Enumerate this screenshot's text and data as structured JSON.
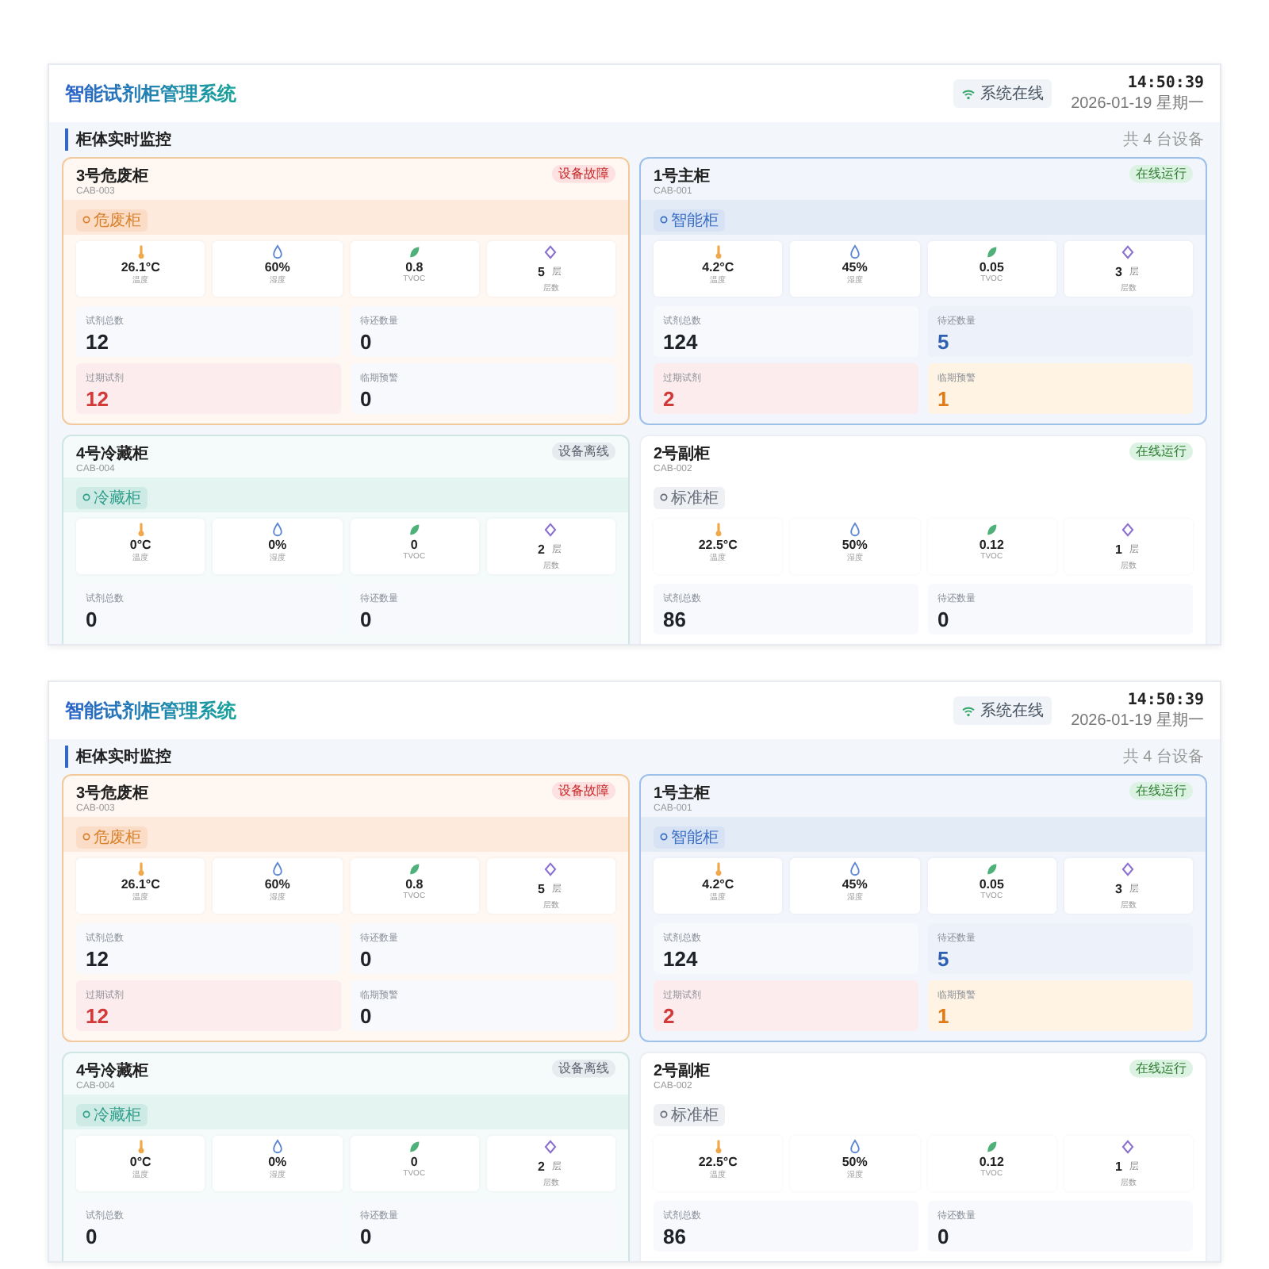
{
  "screens": [
    {
      "header": {
        "title": "智能试剂柜管理系统",
        "status": "系统在线",
        "time": "14:50:39",
        "date": "2026-01-19 星期一"
      },
      "section": {
        "title": "柜体实时监控",
        "count": "共 4 台设备"
      },
      "cabinets": [
        {
          "name": "3号危废柜",
          "code": "CAB-003",
          "kind": "hazard",
          "status": {
            "label": "设备故障",
            "kind": "fault"
          },
          "tag": "危废柜",
          "metrics": [
            {
              "kind": "temperature",
              "value": "26.1°C",
              "label": "温度"
            },
            {
              "kind": "humidity",
              "value": "60%",
              "label": "湿度"
            },
            {
              "kind": "tvoc",
              "value": "0.8",
              "label": "TVOC"
            },
            {
              "kind": "layers",
              "value": "5",
              "unit": "层",
              "label": "层数"
            }
          ],
          "stats": [
            {
              "label": "试剂总数",
              "value": "12",
              "kind": "normal"
            },
            {
              "label": "待还数量",
              "value": "0",
              "kind": "normal"
            },
            {
              "label": "过期试剂",
              "value": "12",
              "kind": "alert"
            },
            {
              "label": "临期预警",
              "value": "0",
              "kind": "normal"
            }
          ]
        },
        {
          "name": "1号主柜",
          "code": "CAB-001",
          "kind": "main",
          "status": {
            "label": "在线运行",
            "kind": "online"
          },
          "tag": "智能柜",
          "metrics": [
            {
              "kind": "temperature",
              "value": "4.2°C",
              "label": "温度"
            },
            {
              "kind": "humidity",
              "value": "45%",
              "label": "湿度"
            },
            {
              "kind": "tvoc",
              "value": "0.05",
              "label": "TVOC"
            },
            {
              "kind": "layers",
              "value": "3",
              "unit": "层",
              "label": "层数"
            }
          ],
          "stats": [
            {
              "label": "试剂总数",
              "value": "124",
              "kind": "normal"
            },
            {
              "label": "待还数量",
              "value": "5",
              "kind": "info"
            },
            {
              "label": "过期试剂",
              "value": "2",
              "kind": "alert"
            },
            {
              "label": "临期预警",
              "value": "1",
              "kind": "warn"
            }
          ]
        },
        {
          "name": "4号冷藏柜",
          "code": "CAB-004",
          "kind": "cold",
          "status": {
            "label": "设备离线",
            "kind": "offline"
          },
          "tag": "冷藏柜",
          "metrics": [
            {
              "kind": "temperature",
              "value": "0°C",
              "label": "温度"
            },
            {
              "kind": "humidity",
              "value": "0%",
              "label": "湿度"
            },
            {
              "kind": "tvoc",
              "value": "0",
              "label": "TVOC"
            },
            {
              "kind": "layers",
              "value": "2",
              "unit": "层",
              "label": "层数"
            }
          ],
          "stats": [
            {
              "label": "试剂总数",
              "value": "0",
              "kind": "normal"
            },
            {
              "label": "待还数量",
              "value": "0",
              "kind": "normal"
            }
          ]
        },
        {
          "name": "2号副柜",
          "code": "CAB-002",
          "kind": "standard",
          "status": {
            "label": "在线运行",
            "kind": "online"
          },
          "tag": "标准柜",
          "metrics": [
            {
              "kind": "temperature",
              "value": "22.5°C",
              "label": "温度"
            },
            {
              "kind": "humidity",
              "value": "50%",
              "label": "湿度"
            },
            {
              "kind": "tvoc",
              "value": "0.12",
              "label": "TVOC"
            },
            {
              "kind": "layers",
              "value": "1",
              "unit": "层",
              "label": "层数"
            }
          ],
          "stats": [
            {
              "label": "试剂总数",
              "value": "86",
              "kind": "normal"
            },
            {
              "label": "待还数量",
              "value": "0",
              "kind": "normal"
            }
          ]
        }
      ]
    },
    {
      "header": {
        "title": "智能试剂柜管理系统",
        "status": "系统在线",
        "time": "14:50:39",
        "date": "2026-01-19 星期一"
      },
      "section": {
        "title": "柜体实时监控",
        "count": "共 4 台设备"
      },
      "cabinets": [
        {
          "name": "3号危废柜",
          "code": "CAB-003",
          "kind": "hazard",
          "status": {
            "label": "设备故障",
            "kind": "fault"
          },
          "tag": "危废柜",
          "metrics": [
            {
              "kind": "temperature",
              "value": "26.1°C",
              "label": "温度"
            },
            {
              "kind": "humidity",
              "value": "60%",
              "label": "湿度"
            },
            {
              "kind": "tvoc",
              "value": "0.8",
              "label": "TVOC"
            },
            {
              "kind": "layers",
              "value": "5",
              "unit": "层",
              "label": "层数"
            }
          ],
          "stats": [
            {
              "label": "试剂总数",
              "value": "12",
              "kind": "normal"
            },
            {
              "label": "待还数量",
              "value": "0",
              "kind": "normal"
            },
            {
              "label": "过期试剂",
              "value": "12",
              "kind": "alert"
            },
            {
              "label": "临期预警",
              "value": "0",
              "kind": "normal"
            }
          ]
        },
        {
          "name": "1号主柜",
          "code": "CAB-001",
          "kind": "main",
          "status": {
            "label": "在线运行",
            "kind": "online"
          },
          "tag": "智能柜",
          "metrics": [
            {
              "kind": "temperature",
              "value": "4.2°C",
              "label": "温度"
            },
            {
              "kind": "humidity",
              "value": "45%",
              "label": "湿度"
            },
            {
              "kind": "tvoc",
              "value": "0.05",
              "label": "TVOC"
            },
            {
              "kind": "layers",
              "value": "3",
              "unit": "层",
              "label": "层数"
            }
          ],
          "stats": [
            {
              "label": "试剂总数",
              "value": "124",
              "kind": "normal"
            },
            {
              "label": "待还数量",
              "value": "5",
              "kind": "info"
            },
            {
              "label": "过期试剂",
              "value": "2",
              "kind": "alert"
            },
            {
              "label": "临期预警",
              "value": "1",
              "kind": "warn"
            }
          ]
        },
        {
          "name": "4号冷藏柜",
          "code": "CAB-004",
          "kind": "cold",
          "status": {
            "label": "设备离线",
            "kind": "offline"
          },
          "tag": "冷藏柜",
          "metrics": [
            {
              "kind": "temperature",
              "value": "0°C",
              "label": "温度"
            },
            {
              "kind": "humidity",
              "value": "0%",
              "label": "湿度"
            },
            {
              "kind": "tvoc",
              "value": "0",
              "label": "TVOC"
            },
            {
              "kind": "layers",
              "value": "2",
              "unit": "层",
              "label": "层数"
            }
          ],
          "stats": [
            {
              "label": "试剂总数",
              "value": "0",
              "kind": "normal"
            },
            {
              "label": "待还数量",
              "value": "0",
              "kind": "normal"
            }
          ]
        },
        {
          "name": "2号副柜",
          "code": "CAB-002",
          "kind": "standard",
          "status": {
            "label": "在线运行",
            "kind": "online"
          },
          "tag": "标准柜",
          "metrics": [
            {
              "kind": "temperature",
              "value": "22.5°C",
              "label": "温度"
            },
            {
              "kind": "humidity",
              "value": "50%",
              "label": "湿度"
            },
            {
              "kind": "tvoc",
              "value": "0.12",
              "label": "TVOC"
            },
            {
              "kind": "layers",
              "value": "1",
              "unit": "层",
              "label": "层数"
            }
          ],
          "stats": [
            {
              "label": "试剂总数",
              "value": "86",
              "kind": "normal"
            },
            {
              "label": "待还数量",
              "value": "0",
              "kind": "normal"
            }
          ]
        }
      ]
    }
  ]
}
